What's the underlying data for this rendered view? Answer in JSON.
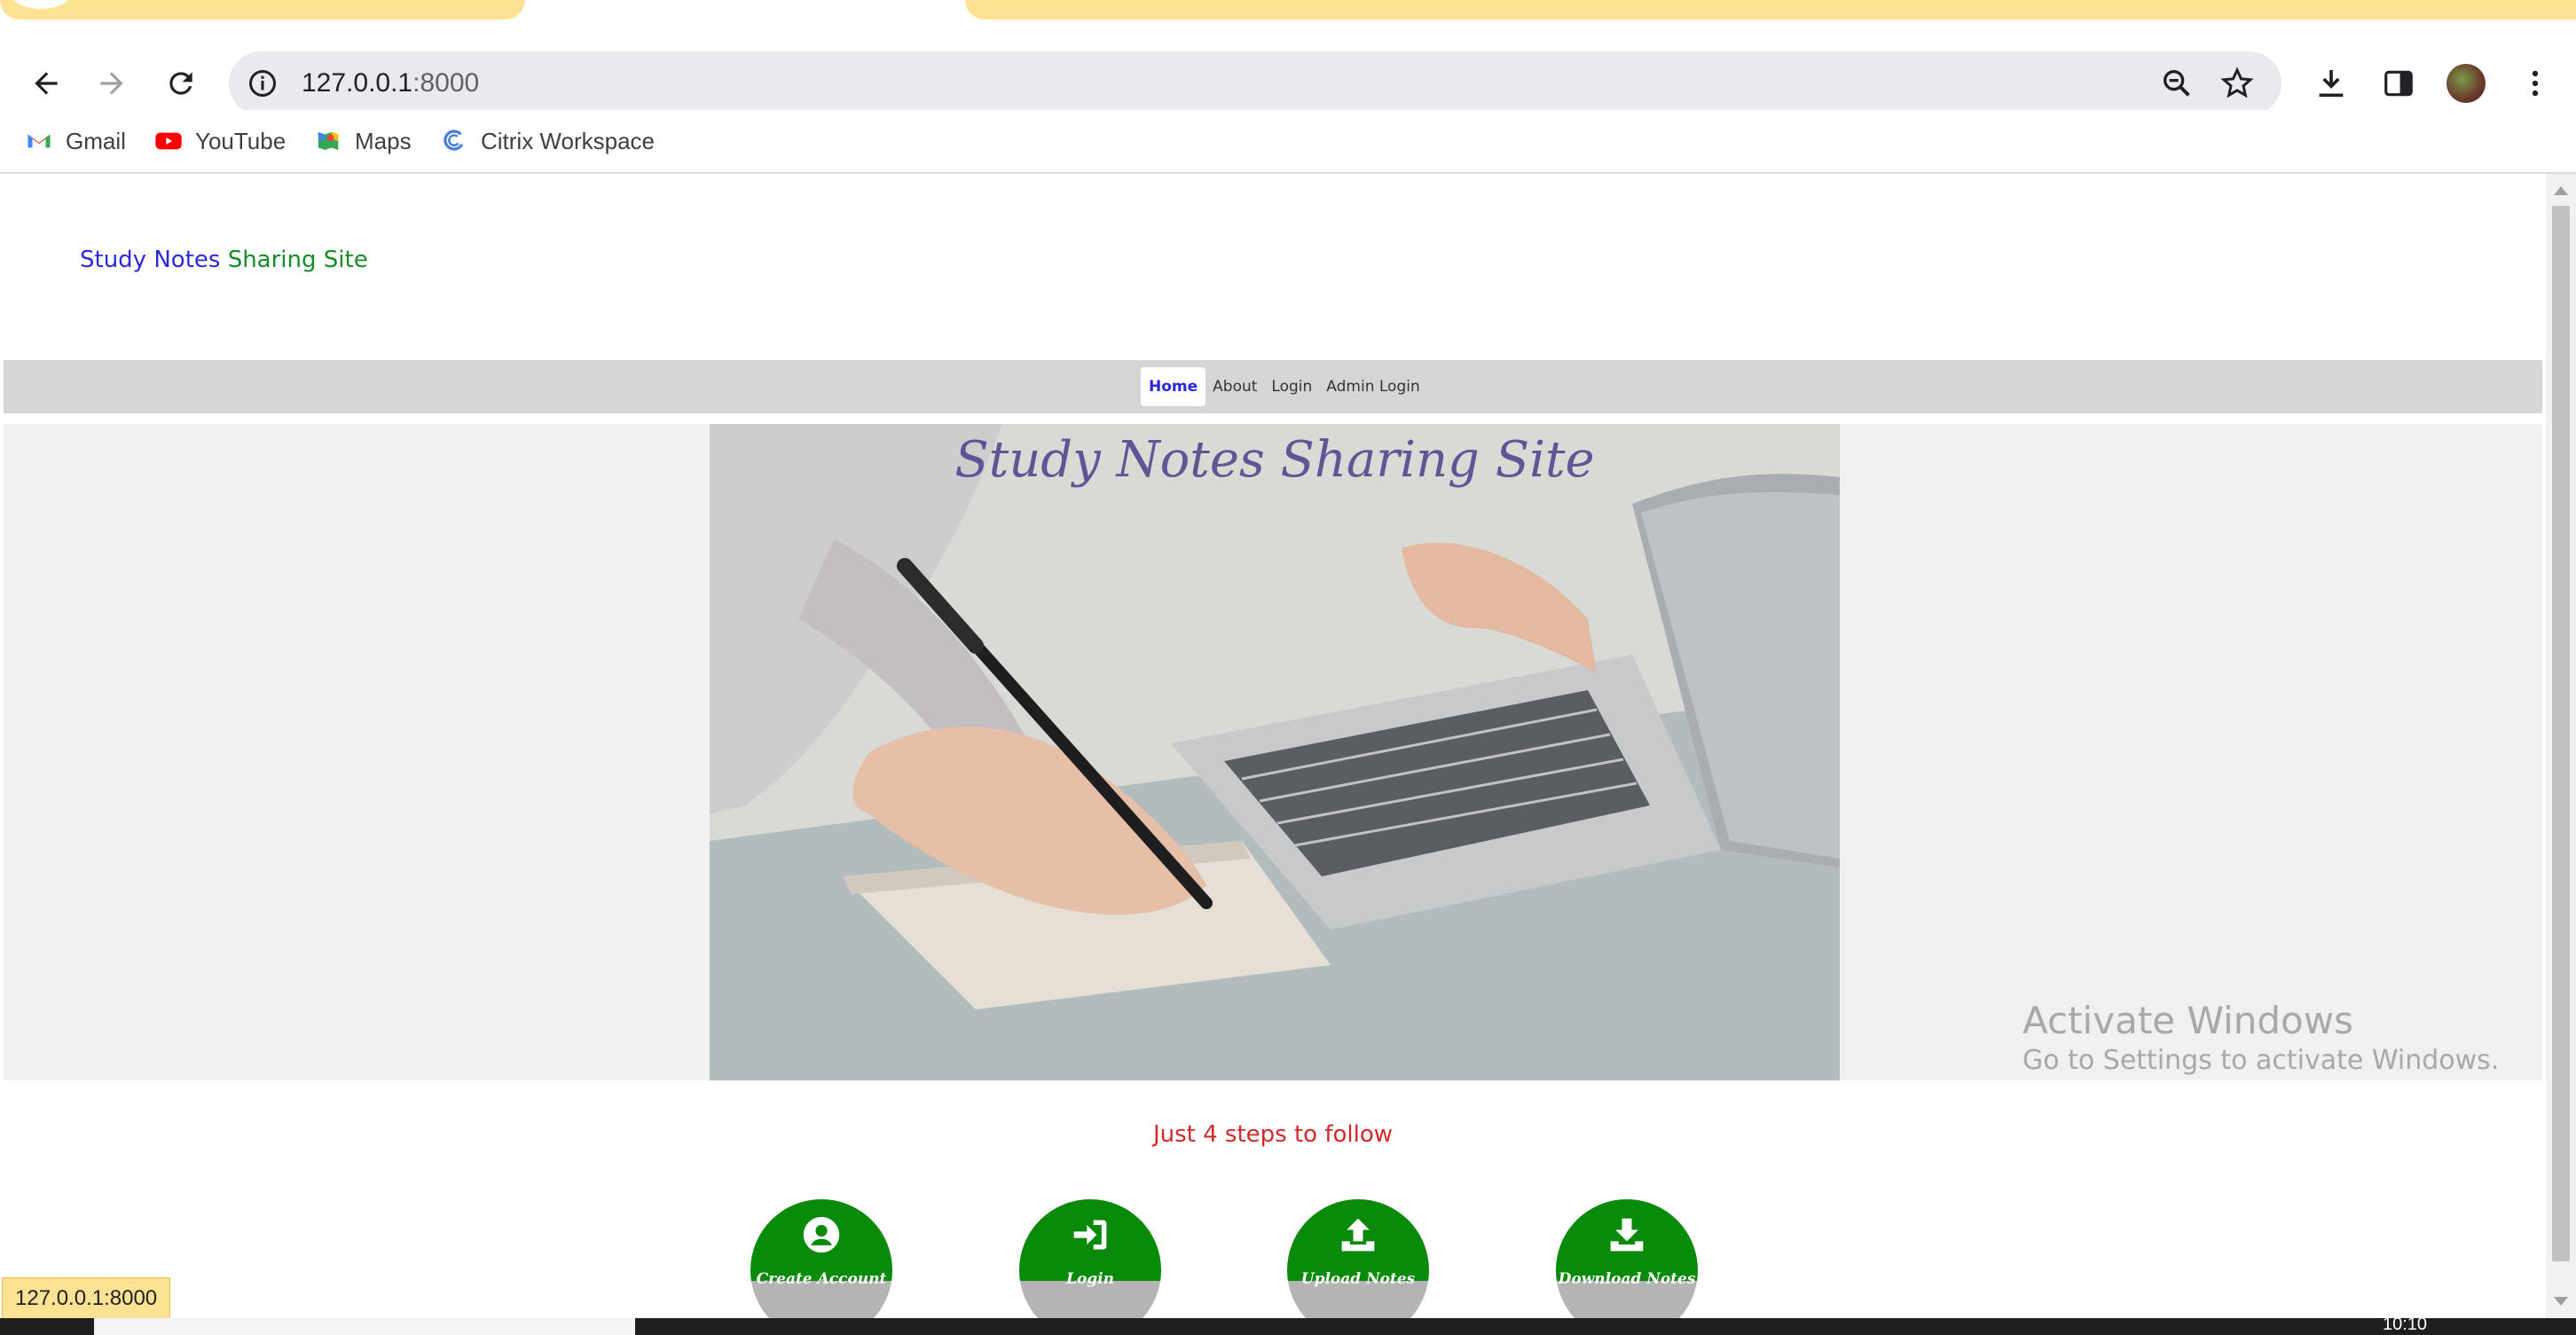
{
  "browser": {
    "url_host": "127.0.0.1",
    "url_port": ":8000",
    "status_url": "127.0.0.1:8000"
  },
  "bookmarks": [
    {
      "label": "Gmail"
    },
    {
      "label": "YouTube"
    },
    {
      "label": "Maps"
    },
    {
      "label": "Citrix Workspace"
    }
  ],
  "site": {
    "title_part1": "Study Notes",
    "title_part2": " Sharing Site",
    "nav": [
      "Home",
      "About",
      "Login",
      "Admin Login"
    ],
    "hero_title": "Study Notes Sharing Site",
    "steps_heading": "Just 4 steps to follow",
    "steps": [
      "Create Account",
      "Login",
      "Upload Notes",
      "Download Notes"
    ]
  },
  "windows": {
    "activate_title": "Activate Windows",
    "activate_subtitle": "Go to Settings to activate Windows.",
    "clock": "10:10"
  },
  "colors": {
    "accent_blue": "#2a2adb",
    "accent_green": "#1a8a2a",
    "step_green": "#0a8a0a",
    "heading_red": "#d12a2a"
  }
}
